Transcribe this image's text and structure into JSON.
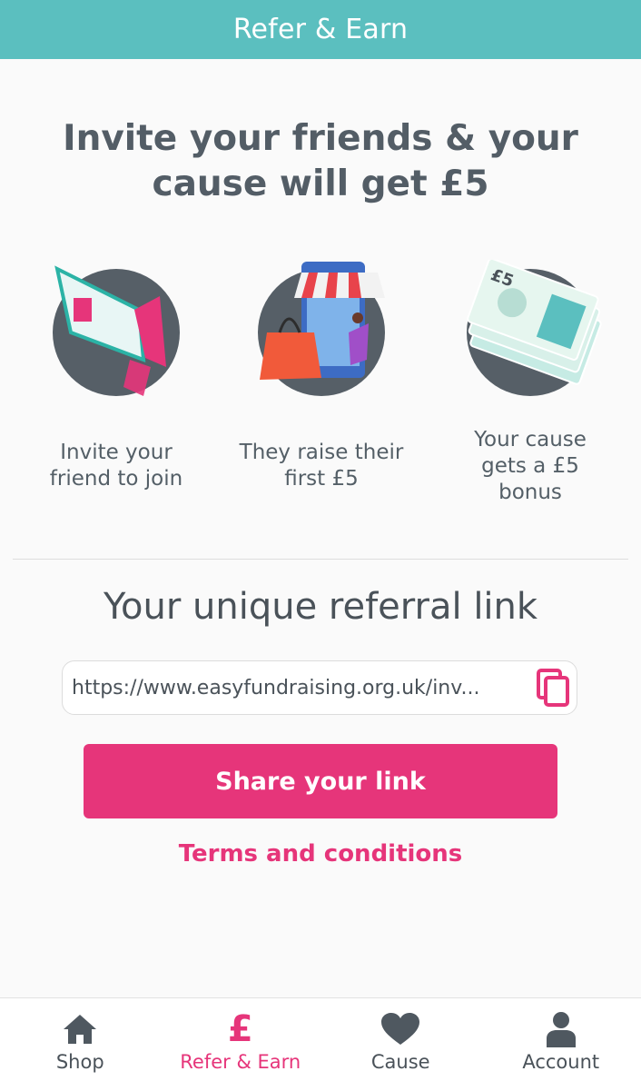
{
  "header": {
    "title": "Refer & Earn"
  },
  "headline": "Invite your friends & your cause will get £5",
  "steps": [
    {
      "icon": "megaphone-icon",
      "caption": "Invite your friend to join"
    },
    {
      "icon": "shopping-icon",
      "caption": "They raise their first £5"
    },
    {
      "icon": "banknote-icon",
      "caption": "Your cause gets a £5 bonus"
    }
  ],
  "referral": {
    "title": "Your unique referral link",
    "link": "https://www.easyfundraising.org.uk/inv...",
    "copy_icon": "copy-icon",
    "share_label": "Share your link",
    "terms_label": "Terms and conditions"
  },
  "tabs": [
    {
      "label": "Shop",
      "icon": "home-icon",
      "active": false
    },
    {
      "label": "Refer & Earn",
      "icon": "pound-icon",
      "active": true
    },
    {
      "label": "Cause",
      "icon": "heart-icon",
      "active": false
    },
    {
      "label": "Account",
      "icon": "person-icon",
      "active": false
    }
  ],
  "colors": {
    "teal": "#5bbfbf",
    "pink": "#e6357a",
    "text": "#545f67"
  }
}
